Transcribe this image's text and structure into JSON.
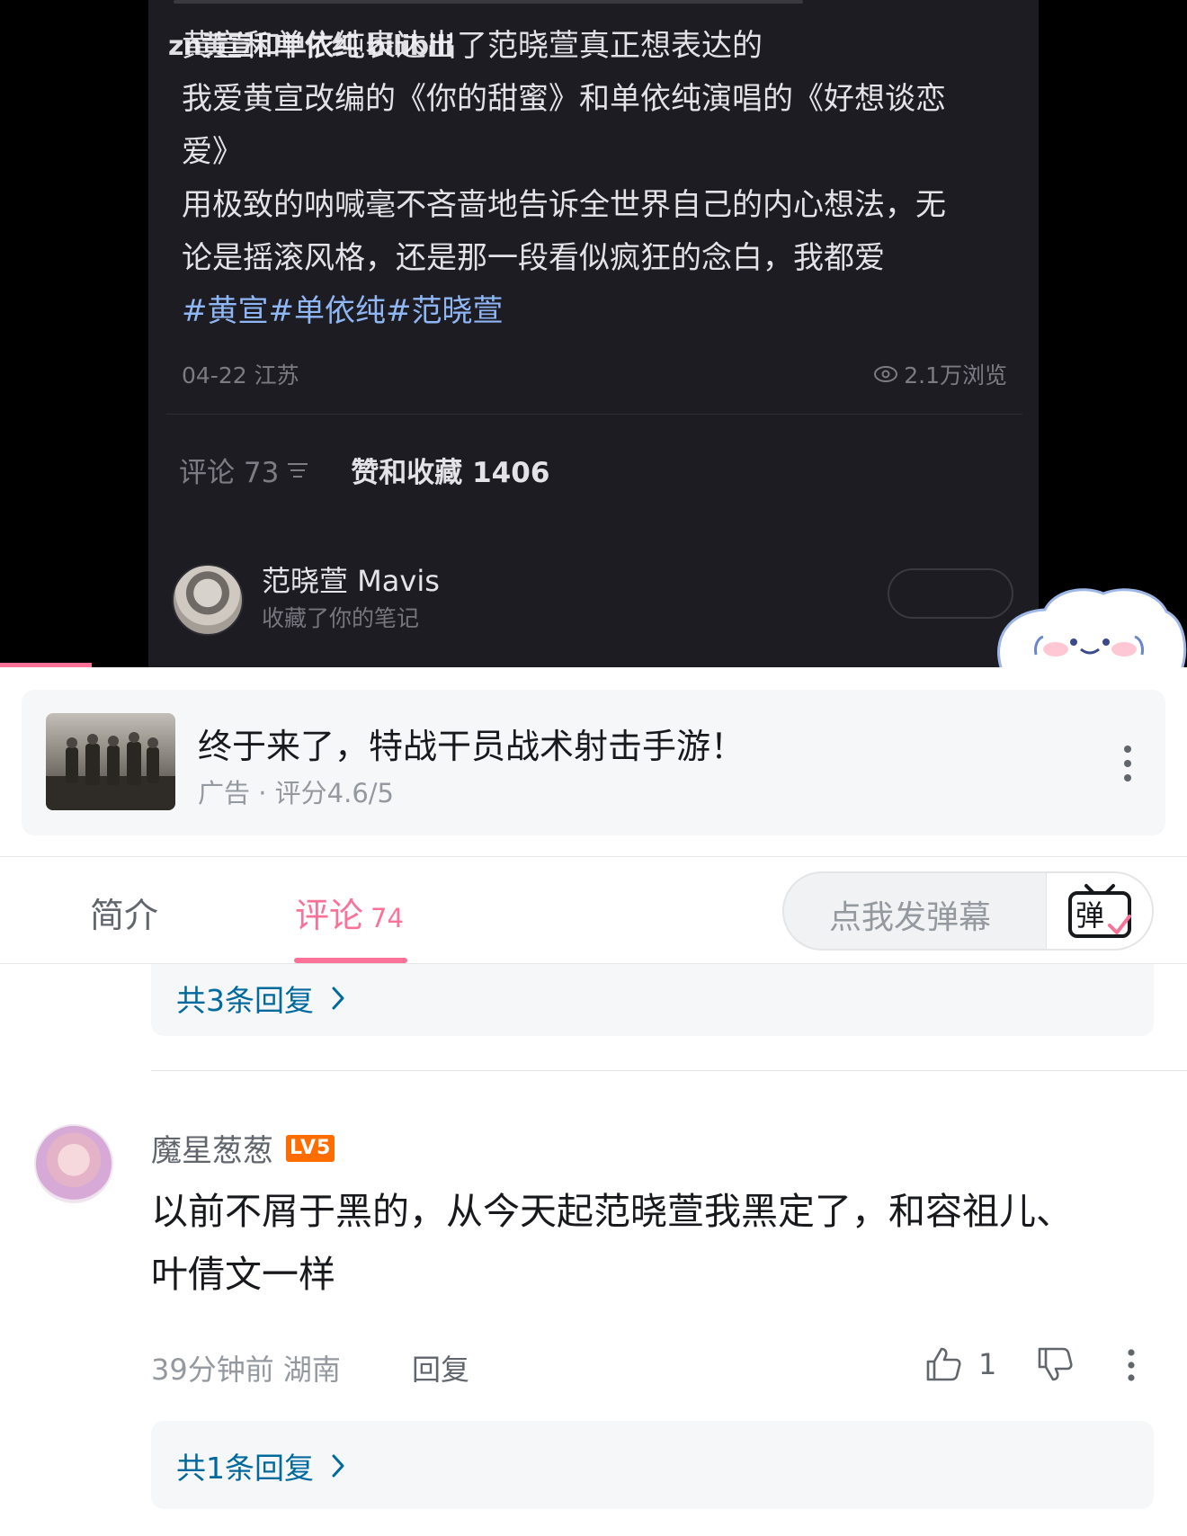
{
  "screenshot_post": {
    "overlay_watermark": "zn黄宣和单依纯 bilibili",
    "lines": [
      "黄宣和单依纯表达出了范晓萱真正想表达的",
      "我爱黄宣改编的《你的甜蜜》和单依纯演唱的《好想谈恋",
      "爱》",
      "用极致的呐喊毫不吝啬地告诉全世界自己的内心想法，无",
      "论是摇滚风格，还是那一段看似疯狂的念白，我都爱"
    ],
    "hashtags": "#黄宣#单依纯#范晓萱",
    "date_location": "04-22 江苏",
    "views": "2.1万浏览",
    "comments_tab": "评论 73",
    "likes_tab": "赞和收藏 1406",
    "notification": {
      "name": "范晓萱 Mavis",
      "action": "收藏了你的笔记"
    }
  },
  "video_progress_fraction": 0.077,
  "ad": {
    "title": "终于来了，特战干员战术射击手游！",
    "subtitle": "广告 · 评分4.6/5"
  },
  "tabs": {
    "intro": "简介",
    "comments": "评论",
    "comments_count": "74",
    "danmaku_placeholder": "点我发弹幕",
    "danmaku_button_glyph": "弹"
  },
  "replies_prev": "共3条回复",
  "comment": {
    "username": "魔星葱葱",
    "level": "LV5",
    "text": "以前不屑于黑的，从今天起范晓萱我黑定了，和容祖儿、叶倩文一样",
    "time": "39分钟前",
    "location": "湖南",
    "reply_label": "回复",
    "likes": "1",
    "replies": "共1条回复"
  },
  "colors": {
    "accent_pink": "#fb7299",
    "link_blue": "#00699d",
    "level_orange": "#ff6c00"
  }
}
